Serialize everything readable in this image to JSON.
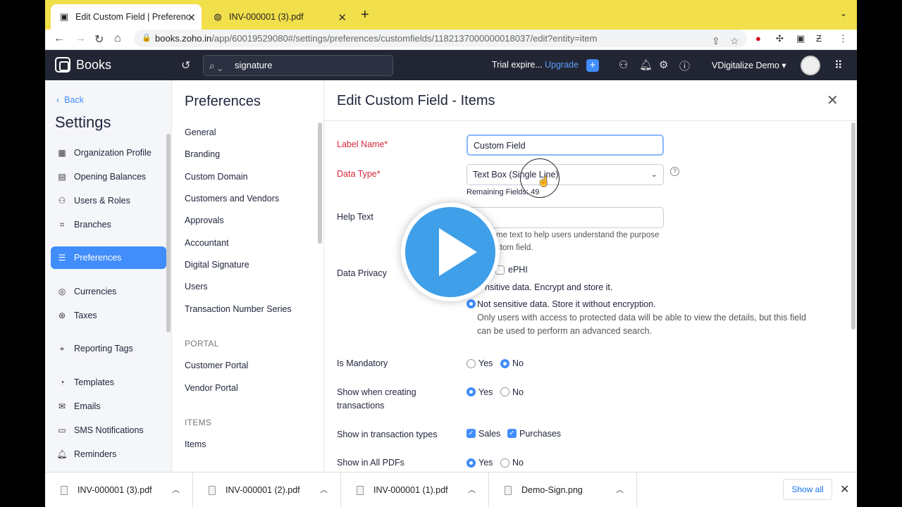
{
  "browser": {
    "tabs": [
      {
        "title": "Edit Custom Field | Preference",
        "active": true
      },
      {
        "title": "INV-000001 (3).pdf",
        "active": false
      }
    ],
    "url_host": "books.zoho.in",
    "url_path": "/app/60019529080#/settings/preferences/customfields/1182137000000018037/edit?entity=item"
  },
  "header": {
    "app_name": "Books",
    "search_value": "signature",
    "trial_text": "Trial expire...",
    "upgrade_label": "Upgrade",
    "org_name": "VDigitalize Demo"
  },
  "sidebar": {
    "back_label": "Back",
    "title": "Settings",
    "items": [
      {
        "label": "Organization Profile",
        "icon": "building-icon"
      },
      {
        "label": "Opening Balances",
        "icon": "ledger-icon"
      },
      {
        "label": "Users & Roles",
        "icon": "users-icon"
      },
      {
        "label": "Branches",
        "icon": "branch-icon"
      },
      {
        "label": "Preferences",
        "icon": "sliders-icon",
        "active": true
      },
      {
        "label": "Currencies",
        "icon": "currency-icon"
      },
      {
        "label": "Taxes",
        "icon": "percent-icon"
      },
      {
        "label": "Reporting Tags",
        "icon": "tag-icon"
      },
      {
        "label": "Templates",
        "icon": "template-icon"
      },
      {
        "label": "Emails",
        "icon": "mail-icon"
      },
      {
        "label": "SMS Notifications",
        "icon": "sms-icon"
      },
      {
        "label": "Reminders",
        "icon": "bell-icon"
      }
    ]
  },
  "preferences": {
    "title": "Preferences",
    "links": [
      "General",
      "Branding",
      "Custom Domain",
      "Customers and Vendors",
      "Approvals",
      "Accountant",
      "Digital Signature",
      "Users",
      "Transaction Number Series"
    ],
    "portal_heading": "PORTAL",
    "portal_links": [
      "Customer Portal",
      "Vendor Portal"
    ],
    "items_heading": "ITEMS",
    "items_links": [
      "Items"
    ]
  },
  "form": {
    "title": "Edit Custom Field - Items",
    "label_name_label": "Label Name*",
    "label_name_value": "Custom Field",
    "data_type_label": "Data Type*",
    "data_type_value": "Text Box (Single Line)",
    "remaining_fields": "Remaining Fields: 49",
    "help_text_label": "Help Text",
    "help_text_value": "",
    "help_note_line1": "me text to help users understand the purpose",
    "help_note_line2": "stom field.",
    "data_privacy_label": "Data Privacy",
    "ephi_label": "ePHI",
    "sensitive_label": "nsitive data. Encrypt and store it.",
    "not_sensitive_label": "Not sensitive data. Store it without encryption.",
    "not_sensitive_note": "Only users with access to protected data will be able to view the details, but this field can be used to perform an advanced search.",
    "mandatory_label": "Is Mandatory",
    "show_creating_label": "Show when creating transactions",
    "show_types_label": "Show in transaction types",
    "sales_label": "Sales",
    "purchases_label": "Purchases",
    "show_pdfs_label": "Show in All PDFs",
    "yes": "Yes",
    "no": "No",
    "is_mandatory": "No",
    "show_when_creating": "Yes",
    "show_in_pdfs": "Yes",
    "sales_checked": true,
    "purchases_checked": true
  },
  "downloads": {
    "files": [
      "INV-000001 (3).pdf",
      "INV-000001 (2).pdf",
      "INV-000001 (1).pdf",
      "Demo-Sign.png"
    ],
    "show_all_label": "Show all"
  },
  "colors": {
    "accent": "#408dfb",
    "header_bg": "#222634",
    "required": "#d6283b",
    "tabbar": "#f1df4b"
  }
}
